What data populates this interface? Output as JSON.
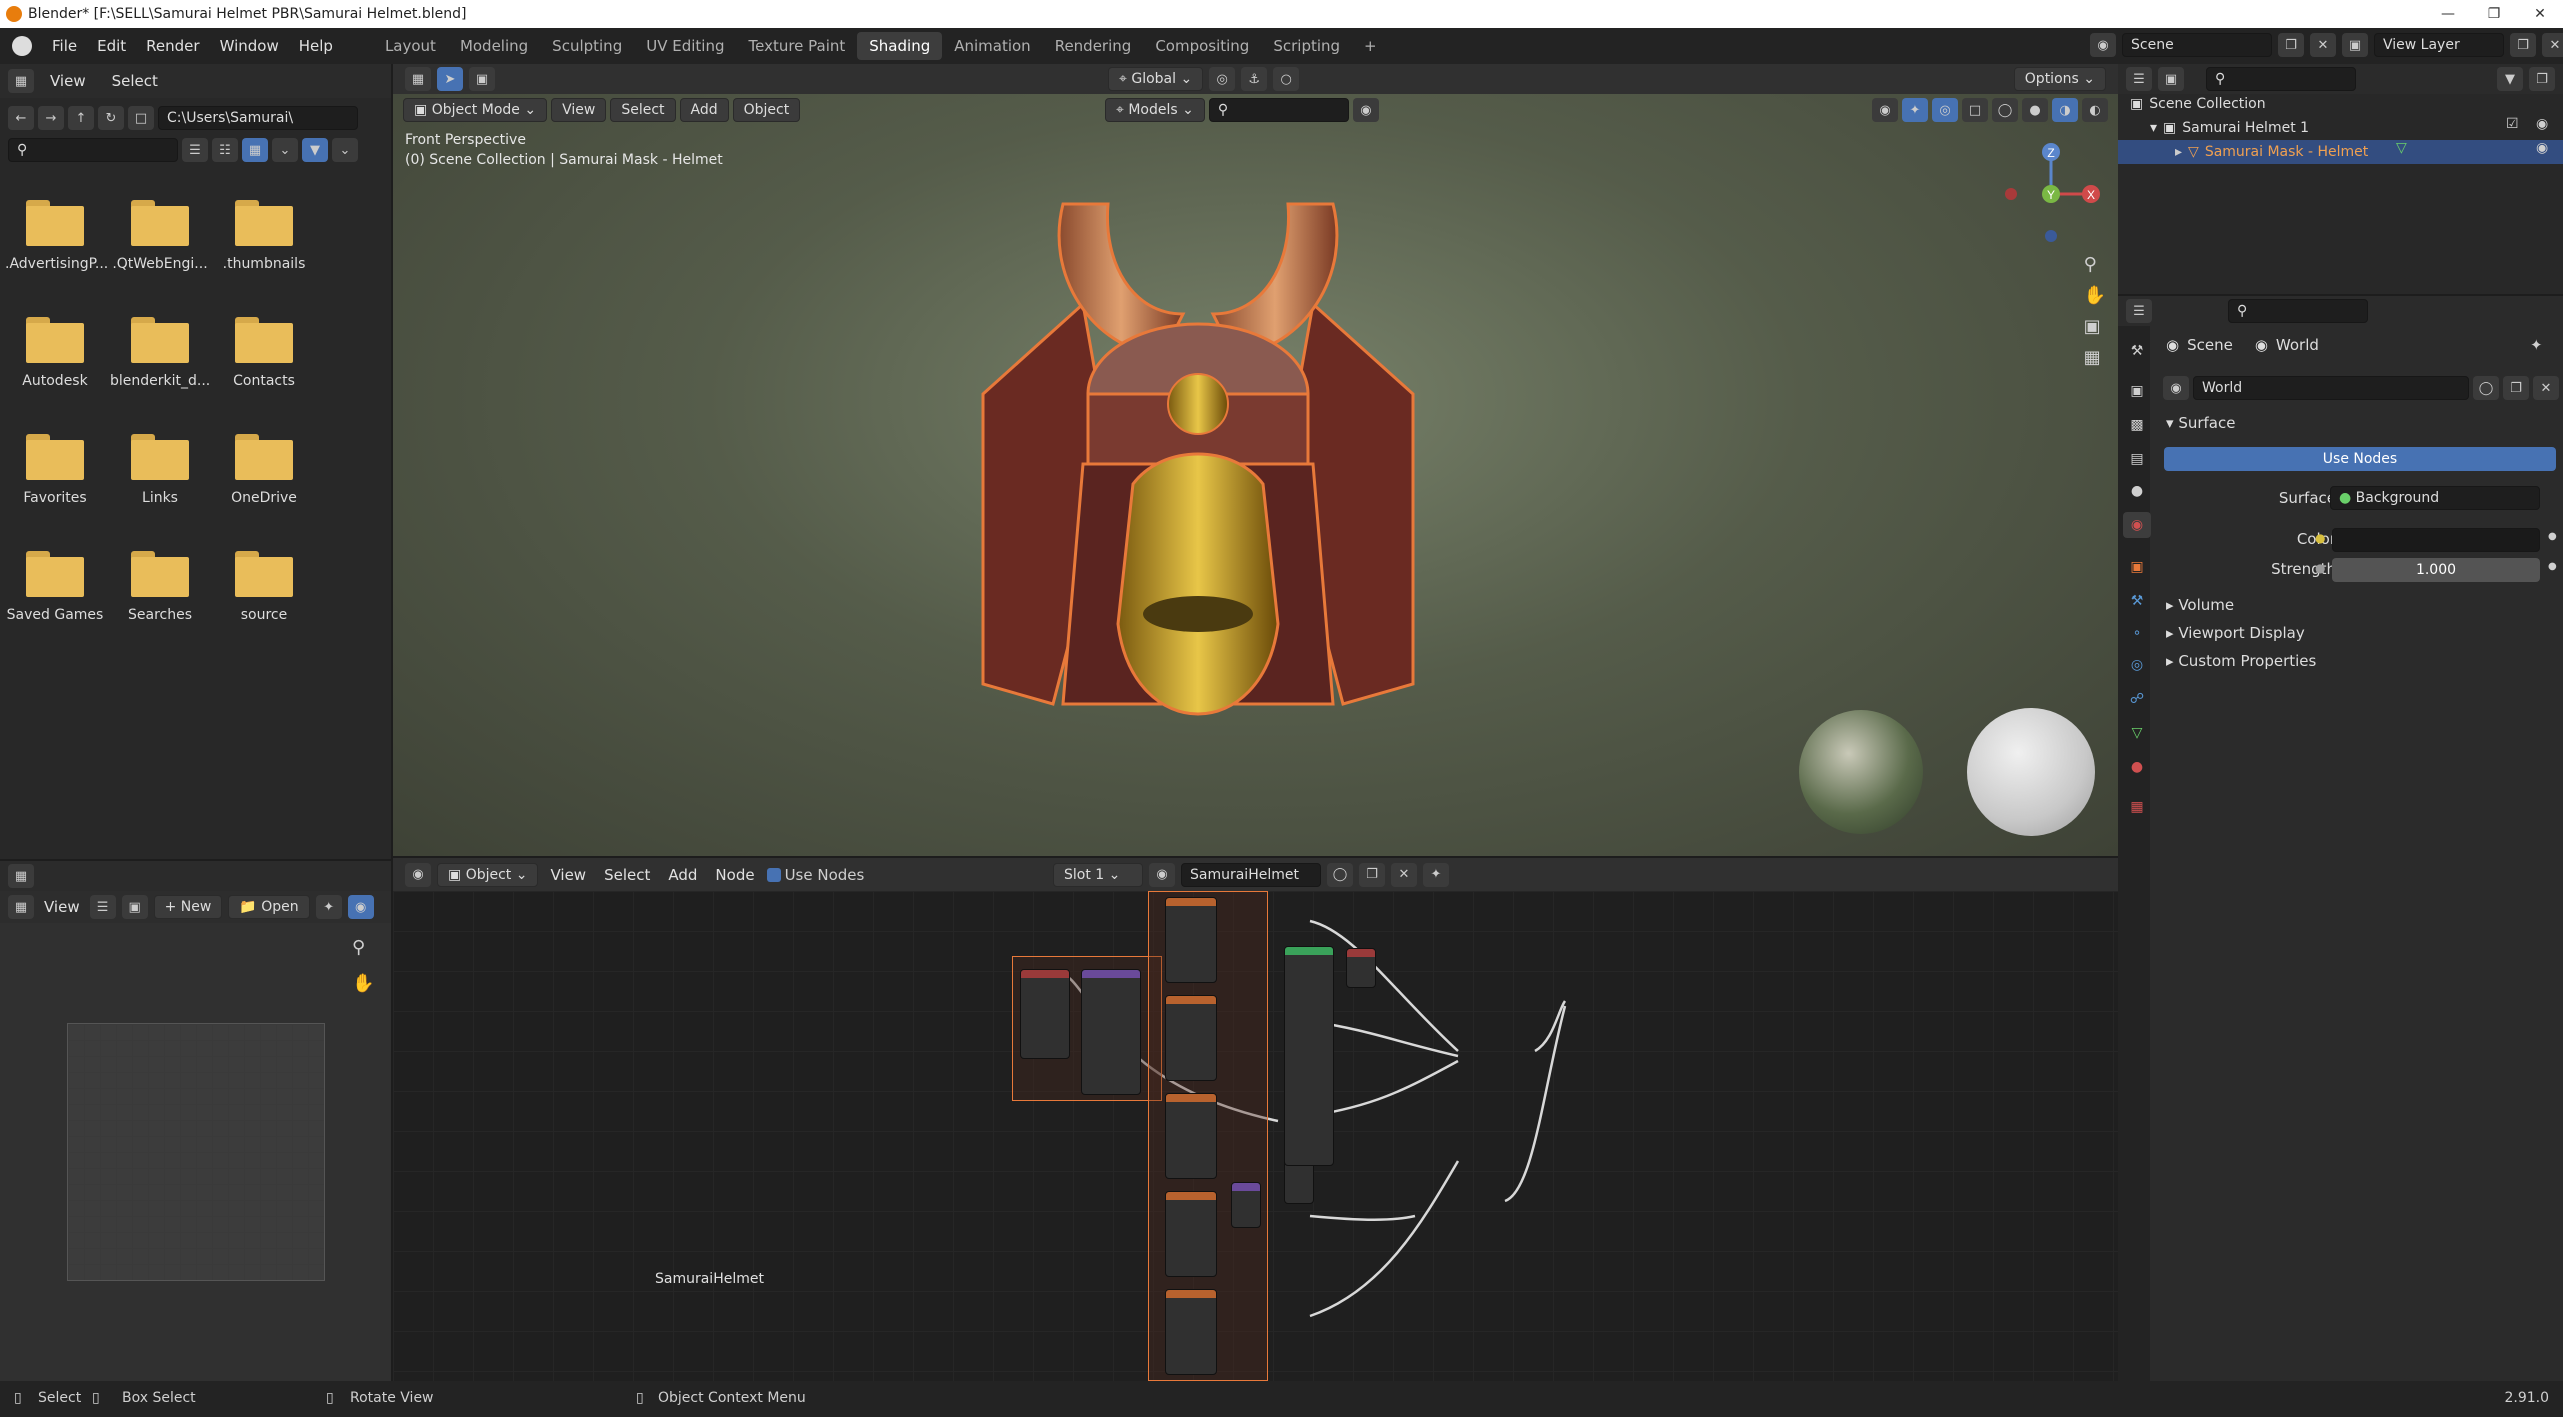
{
  "window": {
    "title": "Blender* [F:\\SELL\\Samurai Helmet PBR\\Samurai Helmet.blend]",
    "version": "2.91.0"
  },
  "menu": [
    "File",
    "Edit",
    "Render",
    "Window",
    "Help"
  ],
  "workspaces": [
    "Layout",
    "Modeling",
    "Sculpting",
    "UV Editing",
    "Texture Paint",
    "Shading",
    "Animation",
    "Rendering",
    "Compositing",
    "Scripting"
  ],
  "active_workspace": "Shading",
  "scene": {
    "name": "Scene",
    "view_layer": "View Layer"
  },
  "filebrowser": {
    "header": [
      "View",
      "Select"
    ],
    "path": "C:\\Users\\Samurai\\",
    "items": [
      ".AdvertisingP...",
      ".QtWebEngi...",
      ".thumbnails",
      "Autodesk",
      "blenderkit_d...",
      "Contacts",
      "Favorites",
      "Links",
      "OneDrive",
      "Saved Games",
      "Searches",
      "source"
    ]
  },
  "viewport": {
    "mode": "Object Mode",
    "menus": [
      "View",
      "Select",
      "Add",
      "Object"
    ],
    "orientation": "Global",
    "options": "Options",
    "collection_filter": "Models",
    "label_line1": "Front Perspective",
    "label_line2": "(0) Scene Collection | Samurai Mask - Helmet"
  },
  "outliner": {
    "root": "Scene Collection",
    "collection": "Samurai Helmet 1",
    "object": "Samurai Mask - Helmet"
  },
  "properties": {
    "breadcrumb_scene": "Scene",
    "breadcrumb_world": "World",
    "world_name": "World",
    "surface_panel": "Surface",
    "use_nodes": "Use Nodes",
    "surface_label": "Surface",
    "surface_value": "Background",
    "color_label": "Color",
    "strength_label": "Strength",
    "strength_value": "1.000",
    "panels": [
      "Volume",
      "Viewport Display",
      "Custom Properties"
    ],
    "colors": {
      "world_color": "#1a1a1a"
    }
  },
  "image_editor": {
    "view": "View",
    "new": "New",
    "open": "Open"
  },
  "node_editor": {
    "type": "Object",
    "menus": [
      "View",
      "Select",
      "Add",
      "Node"
    ],
    "use_nodes": "Use Nodes",
    "slot": "Slot 1",
    "material": "SamuraiHelmet",
    "footer_label": "SamuraiHelmet"
  },
  "statusbar": {
    "select": "Select",
    "box_select": "Box Select",
    "rotate_view": "Rotate View",
    "context_menu": "Object Context Menu"
  }
}
